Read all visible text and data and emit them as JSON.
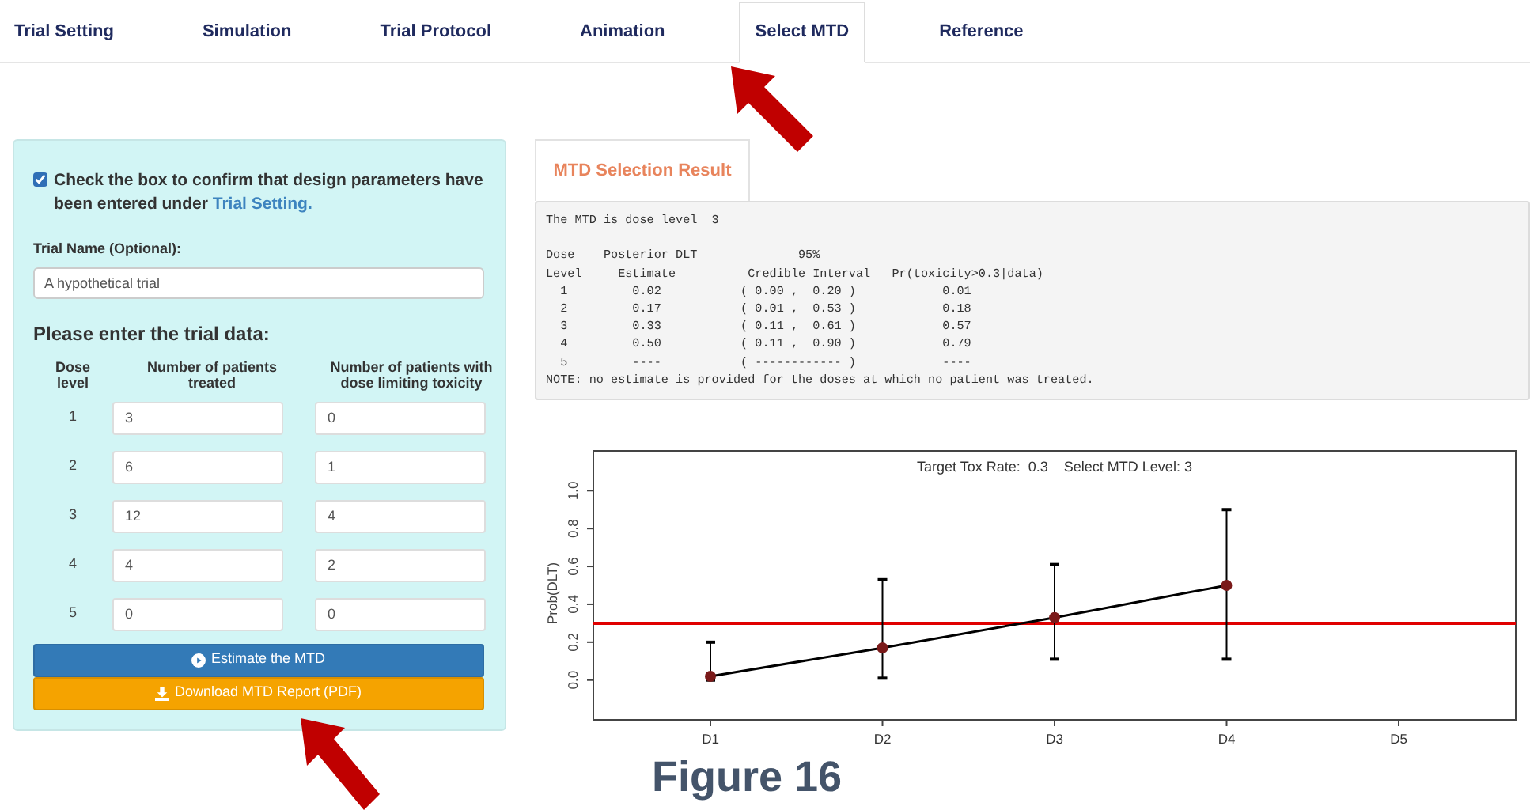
{
  "tabs": [
    {
      "label": "Trial Setting",
      "selected": false
    },
    {
      "label": "Simulation",
      "selected": false
    },
    {
      "label": "Trial Protocol",
      "selected": false
    },
    {
      "label": "Animation",
      "selected": false
    },
    {
      "label": "Select MTD",
      "selected": true
    },
    {
      "label": "Reference",
      "selected": false
    }
  ],
  "form": {
    "confirm": {
      "checked": true,
      "text": "Check the box to confirm that design parameters have been entered under ",
      "link": "Trial Setting."
    },
    "trial_name": {
      "label": "Trial Name (Optional):",
      "value": "A hypothetical trial"
    },
    "heading": "Please enter the trial data:",
    "columns": [
      "Dose level",
      "Number of patients treated",
      "Number of patients with dose limiting toxicity"
    ],
    "rows": [
      {
        "dose": "1",
        "treated": "3",
        "dlt": "0"
      },
      {
        "dose": "2",
        "treated": "6",
        "dlt": "1"
      },
      {
        "dose": "3",
        "treated": "12",
        "dlt": "4"
      },
      {
        "dose": "4",
        "treated": "4",
        "dlt": "2"
      },
      {
        "dose": "5",
        "treated": "0",
        "dlt": "0"
      }
    ],
    "buttons": [
      {
        "kind": "estimate",
        "label": "Estimate the MTD"
      },
      {
        "kind": "download",
        "label": "Download MTD Report (PDF)"
      }
    ]
  },
  "result": {
    "tab": "MTD Selection Result",
    "mtd_line": "The MTD is dose level  3",
    "lines": [
      "Dose    Posterior DLT              95%",
      "Level     Estimate          Credible Interval   Pr(toxicity>0.3|data)",
      "  1         0.02           ( 0.00 ,  0.20 )            0.01",
      "  2         0.17           ( 0.01 ,  0.53 )            0.18",
      "  3         0.33           ( 0.11 ,  0.61 )            0.57",
      "  4         0.50           ( 0.11 ,  0.90 )            0.79",
      "  5         ----           ( ------------ )            ----",
      "NOTE: no estimate is provided for the doses at which no patient was treated."
    ],
    "chart_data": {
      "type": "line",
      "title": "Target Tox Rate:  0.3    Select MTD Level: 3",
      "ylabel": "Prob(DLT)",
      "categories": [
        "D1",
        "D2",
        "D3",
        "D4",
        "D5"
      ],
      "series": [
        {
          "color": "#000000",
          "marker": "circle",
          "values": [
            0.02,
            0.17,
            0.33,
            0.5,
            null
          ],
          "errors": [
            [
              0.0,
              0.2
            ],
            [
              0.01,
              0.53
            ],
            [
              0.11,
              0.61
            ],
            [
              0.11,
              0.9
            ],
            null
          ]
        }
      ],
      "ylim": [
        -0.21,
        1.21
      ],
      "yticks": [
        {
          "value": 0,
          "label": "0.0"
        },
        0.2,
        0.4,
        0.6,
        0.8,
        {
          "value": 1,
          "label": "1.0"
        }
      ],
      "ref_lines": [
        {
          "axis": "y",
          "value": 0.3,
          "color": "#e00000"
        }
      ]
    }
  },
  "caption": "Figure 16"
}
